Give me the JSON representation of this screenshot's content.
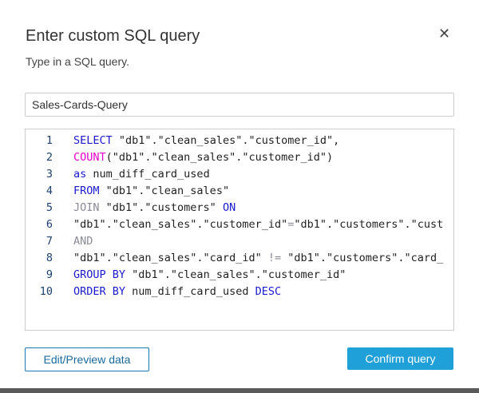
{
  "dialog": {
    "title": "Enter custom SQL query",
    "subtitle": "Type in a SQL query.",
    "close_icon": "close-icon",
    "query_name": "Sales-Cards-Query",
    "edit_label": "Edit/Preview data",
    "confirm_label": "Confirm query"
  },
  "colors": {
    "keyword": "#1a1acc",
    "function": "#e600c8",
    "operator": "#8a8a99",
    "text": "#222222",
    "accent": "#1fa0d8"
  },
  "code": [
    {
      "n": "1",
      "tokens": [
        {
          "t": "SELECT",
          "c": "keyword"
        },
        {
          "t": " \"db1\".\"clean_sales\".\"customer_id\",",
          "c": "text"
        }
      ]
    },
    {
      "n": "2",
      "tokens": [
        {
          "t": "COUNT",
          "c": "function"
        },
        {
          "t": "(\"db1\".\"clean_sales\".\"customer_id\")",
          "c": "text"
        }
      ]
    },
    {
      "n": "3",
      "tokens": [
        {
          "t": "as",
          "c": "keyword"
        },
        {
          "t": " num_diff_card_used",
          "c": "text"
        }
      ]
    },
    {
      "n": "4",
      "tokens": [
        {
          "t": "FROM",
          "c": "keyword"
        },
        {
          "t": " \"db1\".\"clean_sales\"",
          "c": "text"
        }
      ]
    },
    {
      "n": "5",
      "tokens": [
        {
          "t": "JOIN",
          "c": "operator"
        },
        {
          "t": " \"db1\".\"customers\" ",
          "c": "text"
        },
        {
          "t": "ON",
          "c": "keyword"
        }
      ]
    },
    {
      "n": "6",
      "tokens": [
        {
          "t": "\"db1\".\"clean_sales\".\"customer_id\"",
          "c": "text"
        },
        {
          "t": "=",
          "c": "operator"
        },
        {
          "t": "\"db1\".\"customers\".\"cust",
          "c": "text"
        }
      ]
    },
    {
      "n": "7",
      "tokens": [
        {
          "t": "AND",
          "c": "operator"
        }
      ]
    },
    {
      "n": "8",
      "tokens": [
        {
          "t": "\"db1\".\"clean_sales\".\"card_id\" ",
          "c": "text"
        },
        {
          "t": "!=",
          "c": "operator"
        },
        {
          "t": " \"db1\".\"customers\".\"card_",
          "c": "text"
        }
      ]
    },
    {
      "n": "9",
      "tokens": [
        {
          "t": "GROUP BY",
          "c": "keyword"
        },
        {
          "t": " \"db1\".\"clean_sales\".\"customer_id\"",
          "c": "text"
        }
      ]
    },
    {
      "n": "10",
      "tokens": [
        {
          "t": "ORDER BY",
          "c": "keyword"
        },
        {
          "t": " num_diff_card_used ",
          "c": "text"
        },
        {
          "t": "DESC",
          "c": "keyword"
        }
      ]
    }
  ]
}
